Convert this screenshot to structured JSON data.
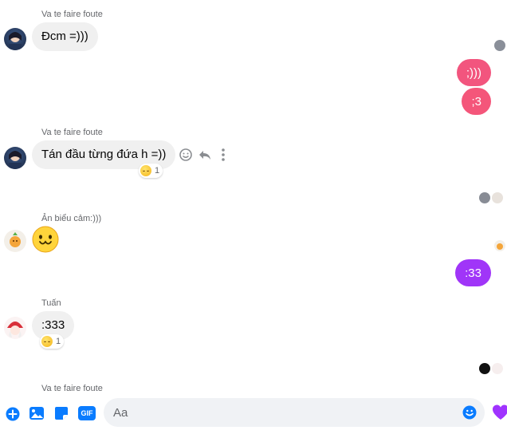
{
  "conversation": {
    "group1": {
      "sender": "Va te faire foute",
      "message": "Đcm =)))"
    },
    "outgoing1": {
      "messages": [
        ";)))",
        ";3"
      ]
    },
    "group2": {
      "sender": "Va te faire foute",
      "message": "Tán đầu từng đứa h =))",
      "reaction_count": "1"
    },
    "group3": {
      "sender": "Ản biểu cảm:)))",
      "sticker": "emoji-face"
    },
    "outgoing2": {
      "message": ":33"
    },
    "group4": {
      "sender": "Tuấn",
      "message": ":333",
      "reaction_count": "1"
    },
    "group5": {
      "sender": "Va te faire foute"
    }
  },
  "composer": {
    "placeholder": "Aa",
    "gif_label": "GIF"
  },
  "colors": {
    "incoming_bubble": "#f0f0f0",
    "outgoing_pink": "#f25a7a",
    "outgoing_purple": "#a033ff",
    "accent_blue": "#0a7cff",
    "composer_bg": "#f0f2f5"
  },
  "icons": {
    "hover_actions": [
      "react-icon",
      "reply-icon",
      "more-icon"
    ],
    "composer_actions": [
      "plus-icon",
      "image-icon",
      "sticker-icon",
      "gif-icon"
    ],
    "send": "heart-icon"
  }
}
